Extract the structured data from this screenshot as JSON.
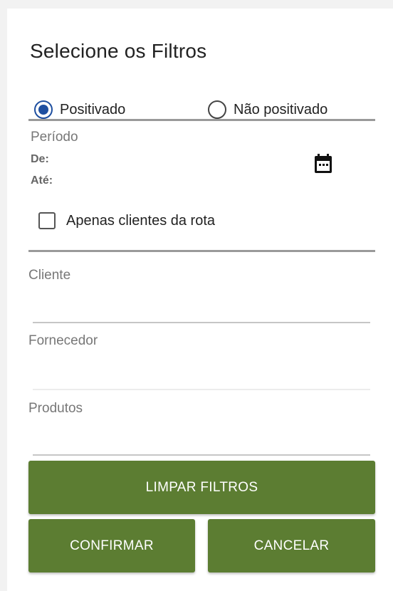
{
  "dialog": {
    "title": "Selecione os Filtros",
    "radio_options": [
      {
        "label": "Positivado",
        "selected": true
      },
      {
        "label": "Não positivado",
        "selected": false
      }
    ],
    "period": {
      "label": "Período",
      "from_label": "De:",
      "to_label": "Até:",
      "calendar_icon": "calendar-icon"
    },
    "route_checkbox": {
      "label": "Apenas clientes da rota",
      "checked": false
    },
    "fields": {
      "cliente": {
        "label": "Cliente",
        "value": ""
      },
      "fornecedor": {
        "label": "Fornecedor",
        "value": ""
      },
      "produtos": {
        "label": "Produtos",
        "value": ""
      }
    },
    "buttons": {
      "clear_label": "LIMPAR FILTROS",
      "confirm_label": "CONFIRMAR",
      "cancel_label": "CANCELAR"
    },
    "colors": {
      "button_bg": "#5c7d32",
      "radio_selected": "#1e4fa0",
      "divider": "#9a9a9a"
    }
  }
}
